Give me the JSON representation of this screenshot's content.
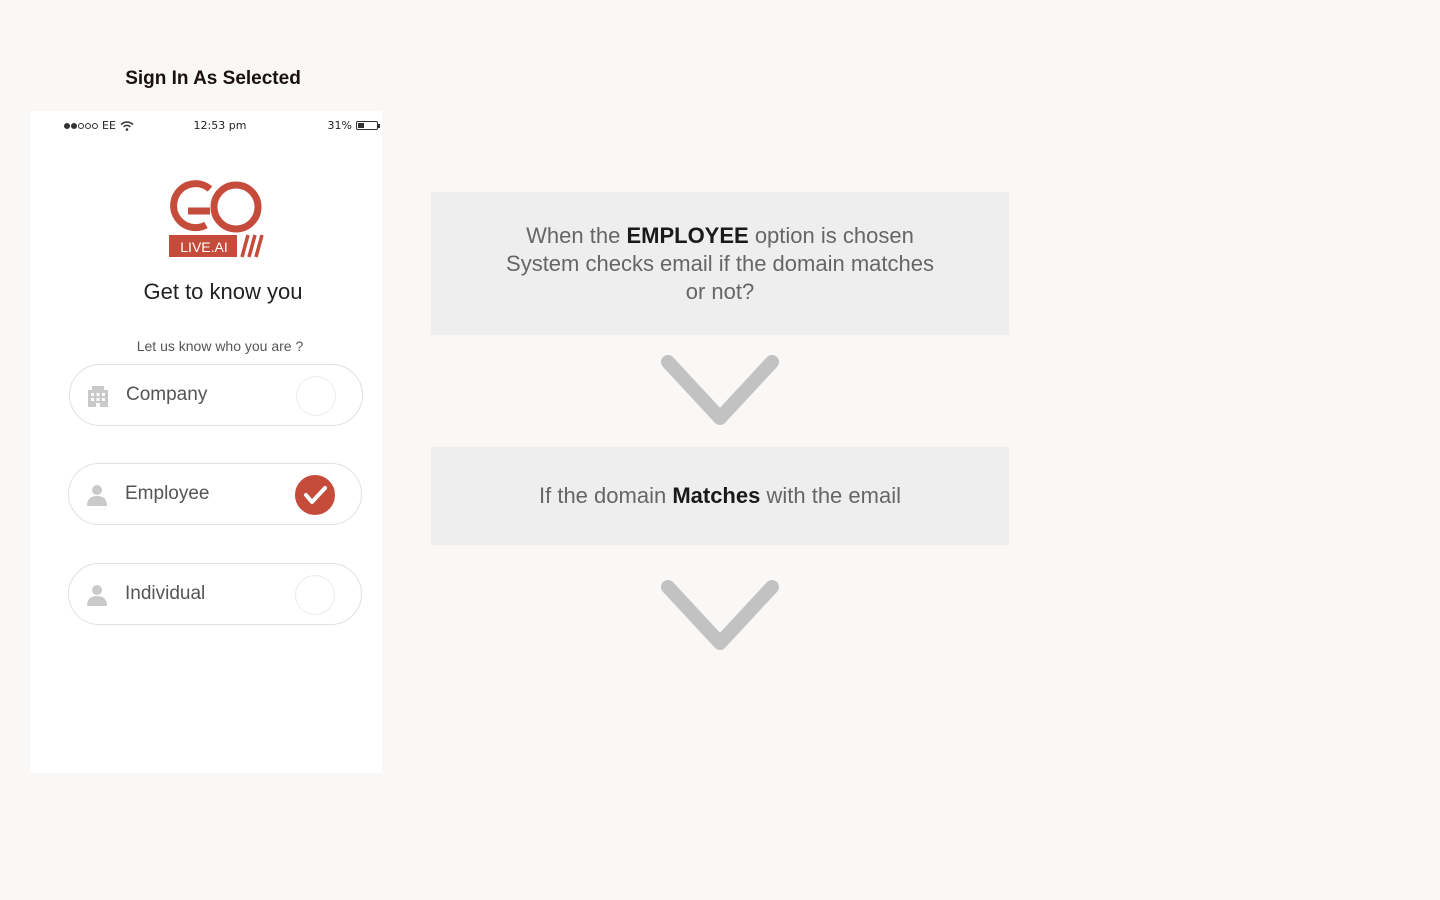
{
  "page": {
    "title": "Sign In As Selected"
  },
  "phone": {
    "status": {
      "carrier": "EE",
      "time": "12:53 pm",
      "battery": "31%",
      "battery_level": 0.31
    },
    "logo": {
      "brand_text": "LIVE.AI",
      "icon": "golive-logo",
      "brand_color": "#c54b3b"
    },
    "heading": "Get to know you",
    "subheading": "Let us know who you are ?",
    "options": [
      {
        "label": "Company",
        "icon": "building-icon",
        "selected": false
      },
      {
        "label": "Employee",
        "icon": "person-icon",
        "selected": true
      },
      {
        "label": "Individual",
        "icon": "person-icon",
        "selected": false
      }
    ]
  },
  "flow": {
    "step1": {
      "pre": "When the ",
      "bold": "EMPLOYEE",
      "post": " option is chosen",
      "line2": "System checks email if the domain matches",
      "line3": "or not?"
    },
    "step2": {
      "pre": "If the domain ",
      "bold": "Matches",
      "post": " with the email"
    },
    "arrow_icon": "chevron-down-icon"
  },
  "colors": {
    "accent": "#c54b3b",
    "background": "#f9f8f7",
    "box": "#efeeee",
    "chevron": "#c2c2c2"
  }
}
